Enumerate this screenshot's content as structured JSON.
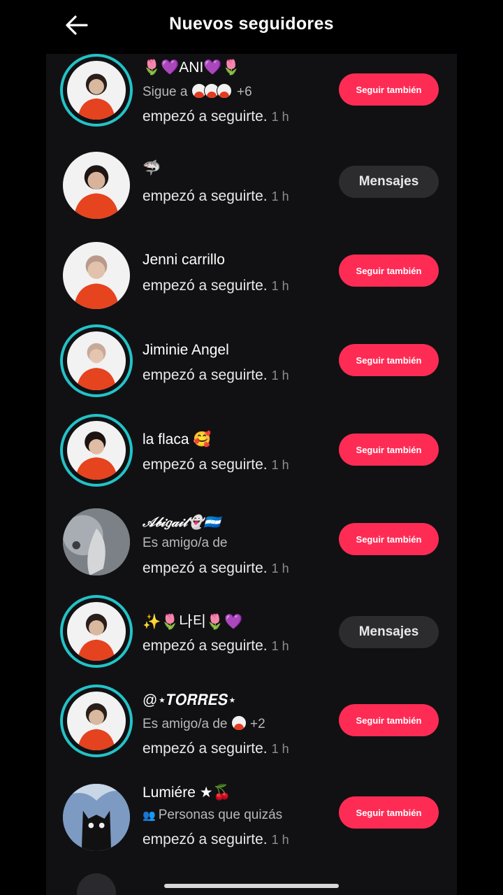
{
  "header": {
    "title": "Nuevos seguidores"
  },
  "colors": {
    "accent": "#fe2c55",
    "ring": "#22c3c8",
    "panel": "#111113"
  },
  "labels": {
    "activity": "empezó a seguirte.",
    "follow_back": "Seguir también",
    "message": "Mensajes"
  },
  "followers": [
    {
      "name": "🌷💜ANI💜🌷",
      "sub_prefix": "Sigue a",
      "sub_suffix": "+6",
      "time": "1 h",
      "button": "Seguir también",
      "button_kind": "follow"
    },
    {
      "name": "🦈",
      "time": "1 h",
      "button": "Mensajes",
      "button_kind": "message"
    },
    {
      "name": "Jenni carrillo",
      "time": "1 h",
      "button": "Seguir también",
      "button_kind": "follow"
    },
    {
      "name": "Jiminie Angel",
      "time": "1 h",
      "button": "Seguir también",
      "button_kind": "follow"
    },
    {
      "name": "la flaca 🥰",
      "time": "1 h",
      "button": "Seguir también",
      "button_kind": "follow"
    },
    {
      "name": "𝒜𝒷𝒾𝑔𝒶𝒾𝓁👻🇭🇳",
      "sub": "Es amigo/a de",
      "time": "1 h",
      "button": "Seguir también",
      "button_kind": "follow"
    },
    {
      "name": "✨🌷나티🌷💜",
      "time": "1 h",
      "button": "Mensajes",
      "button_kind": "message"
    },
    {
      "name": "@⋆𝑻𝑶𝑹𝑹𝑬𝑺⋆",
      "sub_prefix": "Es amigo/a de",
      "sub_suffix": "+2",
      "time": "1 h",
      "button": "Seguir también",
      "button_kind": "follow"
    },
    {
      "name": "Lumiére ★🍒",
      "sub": "Personas que quizás",
      "time": "1 h",
      "button": "Seguir también",
      "button_kind": "follow"
    }
  ]
}
